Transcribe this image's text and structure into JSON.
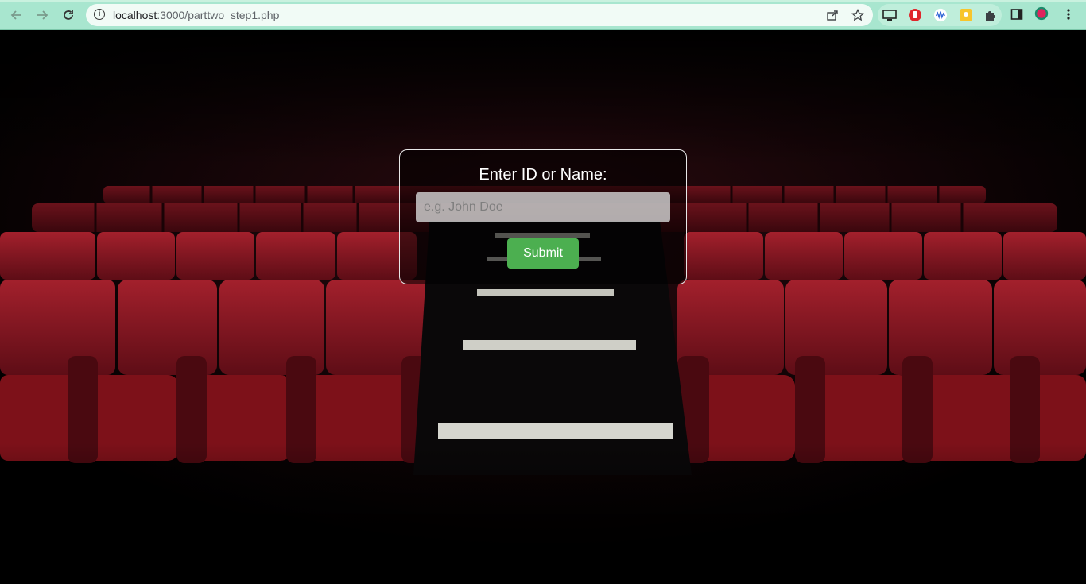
{
  "browser": {
    "url_host": "localhost",
    "url_path": ":3000/parttwo_step1.php",
    "icons": {
      "back": "arrow-left-icon",
      "forward": "arrow-right-icon",
      "reload": "reload-icon",
      "site_info": "info-icon",
      "share": "share-icon",
      "bookmark": "star-icon",
      "cast": "cast-icon",
      "extensions": "puzzle-icon",
      "side_panel": "side-panel-icon",
      "menu": "kebab-menu-icon"
    }
  },
  "form": {
    "title": "Enter ID or Name:",
    "placeholder": "e.g. John Doe",
    "submit_label": "Submit"
  },
  "colors": {
    "toolbar": "#a8e6cf",
    "submit": "#4caf50",
    "seat": "#8c1520"
  }
}
